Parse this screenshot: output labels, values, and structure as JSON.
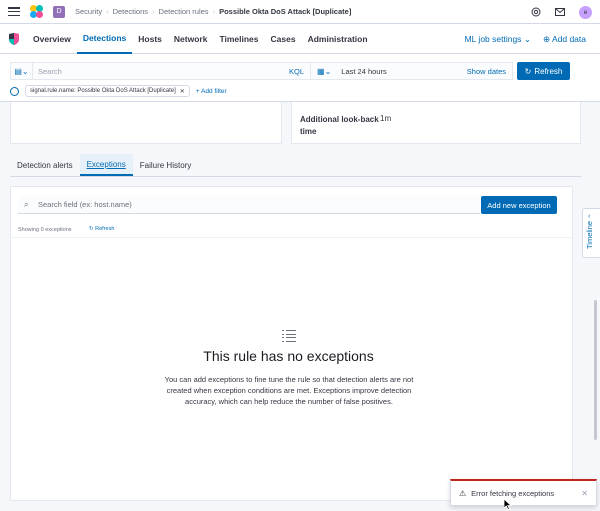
{
  "header": {
    "breadcrumbs": [
      "Security",
      "Detections",
      "Detection rules",
      "Possible Okta DoS Attack [Duplicate]"
    ],
    "space_initial": "D",
    "user_initial": "e"
  },
  "nav": {
    "tabs": [
      {
        "label": "Overview",
        "active": false
      },
      {
        "label": "Detections",
        "active": true
      },
      {
        "label": "Hosts",
        "active": false
      },
      {
        "label": "Network",
        "active": false
      },
      {
        "label": "Timelines",
        "active": false
      },
      {
        "label": "Cases",
        "active": false
      },
      {
        "label": "Administration",
        "active": false
      }
    ],
    "ml_job_settings": "ML job settings",
    "add_data": "Add data"
  },
  "query": {
    "search_placeholder": "Search",
    "language": "KQL",
    "date_range": "Last 24 hours",
    "show_dates": "Show dates",
    "refresh": "Refresh",
    "filter_pill": "signal.rule.name: Possible Okta DoS Attack [Duplicate]",
    "add_filter": "+ Add filter"
  },
  "rule_details": {
    "lookback_label": "Additional look-back time",
    "lookback_value": "1m"
  },
  "rule_tabs": [
    {
      "label": "Detection alerts",
      "active": false
    },
    {
      "label": "Exceptions",
      "active": true
    },
    {
      "label": "Failure History",
      "active": false
    }
  ],
  "exceptions": {
    "search_placeholder": "Search field (ex: host.name)",
    "add_button": "Add new exception",
    "count_text": "Showing 0 exceptions",
    "refresh": "Refresh",
    "empty_title": "This rule has no exceptions",
    "empty_body": "You can add exceptions to fine tune the rule so that detection alerts are not created when exception conditions are met. Exceptions improve detection accuracy, which can help reduce the number of false positives."
  },
  "timeline_label": "Timeline",
  "toast": {
    "message": "Error fetching exceptions"
  },
  "colors": {
    "primary": "#006bb4",
    "danger": "#bd271e",
    "space_avatar": "#9170b8"
  },
  "icons": [
    "menu-icon",
    "elastic-logo-icon",
    "help-icon",
    "mail-icon",
    "shield-icon",
    "chevron-down-icon",
    "plus-circle-icon",
    "calendar-icon",
    "refresh-icon",
    "filter-options-icon",
    "close-icon",
    "search-icon",
    "list-icon",
    "warning-icon",
    "chevron-left-icon"
  ]
}
